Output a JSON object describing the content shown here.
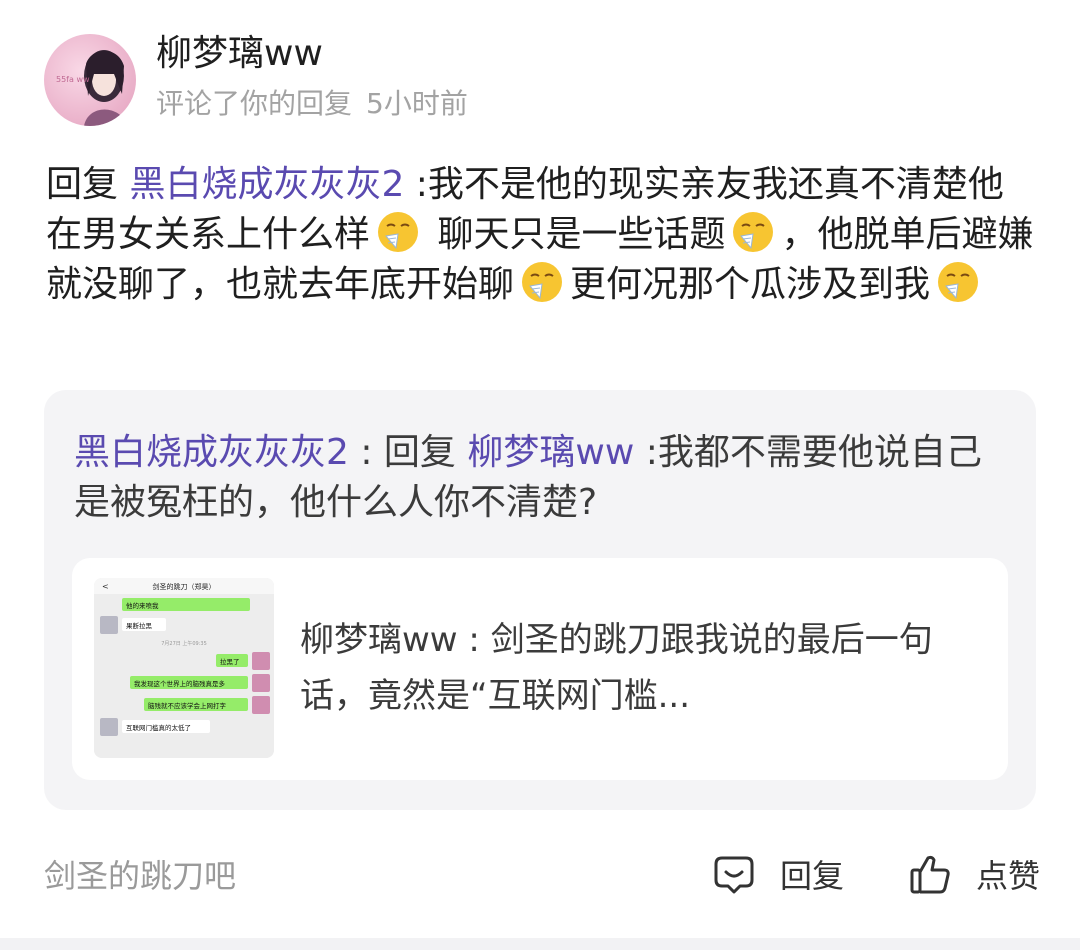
{
  "post": {
    "author": "柳梦璃ww",
    "action_text": "评论了你的回复",
    "time": "5小时前",
    "avatar_label": "avatar"
  },
  "comment": {
    "prefix": "回复 ",
    "mention": "黑白烧成灰灰灰2",
    "part1": " :我不是他的现实亲友我还真不清楚他在男女关系上什么样",
    "part2": " 聊天只是一些话题",
    "part3": "，他脱单后避嫌就没聊了，也就去年底开始聊",
    "part4": "更何况那个瓜涉及到我",
    "emoji_name": "sneezing-face-icon"
  },
  "quote": {
    "author": "黑白烧成灰灰灰2",
    "sep": " : 回复 ",
    "mention": "柳梦璃ww",
    "text": " :我都不需要他说自己是被冤枉的，他什么人你不清楚?",
    "inner": {
      "author": "柳梦璃ww",
      "text": " : 剑圣的跳刀跟我说的最后一句话，竟然是“互联网门槛...",
      "thumbnail": {
        "title": "剑圣的跳刀（郑昊）",
        "date": "7月27日 上午09:35",
        "messages": [
          {
            "side": "right",
            "text": "他的来喷我"
          },
          {
            "side": "left",
            "text": "果断拉黑"
          },
          {
            "side": "right",
            "text": "拉黑了"
          },
          {
            "side": "right",
            "text": "我发现这个世界上的脑残真是多"
          },
          {
            "side": "right",
            "text": "脑残就不应该学会上网打字"
          },
          {
            "side": "left",
            "text": "互联网门槛真的太低了"
          }
        ]
      }
    }
  },
  "footer": {
    "forum": "剑圣的跳刀吧",
    "reply_label": "回复",
    "like_label": "点赞"
  },
  "colors": {
    "link": "#5a4ab0",
    "muted": "#a3a3a3",
    "card_bg": "#f4f4f6"
  }
}
